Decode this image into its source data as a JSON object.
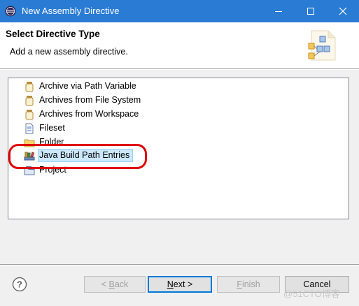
{
  "window": {
    "title": "New Assembly Directive",
    "titlebar_color": "#2a7bd4"
  },
  "header": {
    "title": "Select Directive Type",
    "description": "Add a new assembly directive."
  },
  "tree": {
    "items": [
      {
        "label": "Archive via Path Variable",
        "icon": "jar-icon"
      },
      {
        "label": "Archives from File System",
        "icon": "jar-icon"
      },
      {
        "label": "Archives from Workspace",
        "icon": "jar-icon"
      },
      {
        "label": "Fileset",
        "icon": "fileset-icon"
      },
      {
        "label": "Folder",
        "icon": "folder-icon"
      },
      {
        "label": "Java Build Path Entries",
        "icon": "library-icon",
        "selected": true
      },
      {
        "label": "Project",
        "icon": "project-icon"
      }
    ]
  },
  "buttons": {
    "back_prefix": "< ",
    "back_access": "B",
    "back_rest": "ack",
    "next_access": "N",
    "next_rest": "ext >",
    "finish_access": "F",
    "finish_rest": "inish",
    "cancel": "Cancel"
  },
  "watermark": "@51CTO博客",
  "colors": {
    "highlight": "#e00000",
    "selection": "#cce8ff"
  }
}
